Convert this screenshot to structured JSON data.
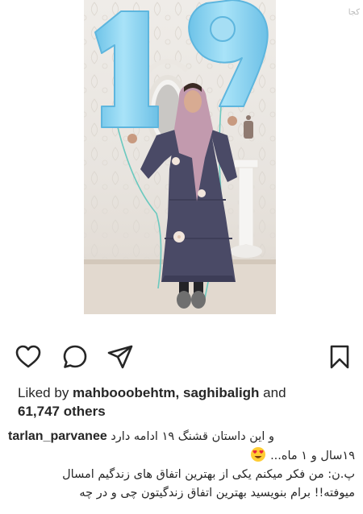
{
  "post": {
    "watermark": "کجا"
  },
  "actions": {
    "like": "heart-icon",
    "comment": "comment-bubble-icon",
    "share": "paper-plane-icon",
    "save": "bookmark-icon"
  },
  "likes": {
    "prefix": "Liked by ",
    "users": "mahbooobehtm, saghibaligh",
    "middle": " and",
    "count": "61,747 others"
  },
  "caption": {
    "username": "tarlan_parvanee",
    "line1": "و این داستان قشنگ ۱۹ ادامه دارد",
    "line2": "۱۹سال و ۱ ماه...",
    "line3": "پ.ن: من فکر میکنم یکی از بهترین اتفاق های زندگیم امسال",
    "line4": "میوفته!! برام بنویسید بهترین اتفاق زندگیتون چی و در چه"
  },
  "colors": {
    "text": "#262626",
    "balloon": "#8fd6f2",
    "dress": "#4a4a66",
    "hijab": "#c29aae"
  }
}
